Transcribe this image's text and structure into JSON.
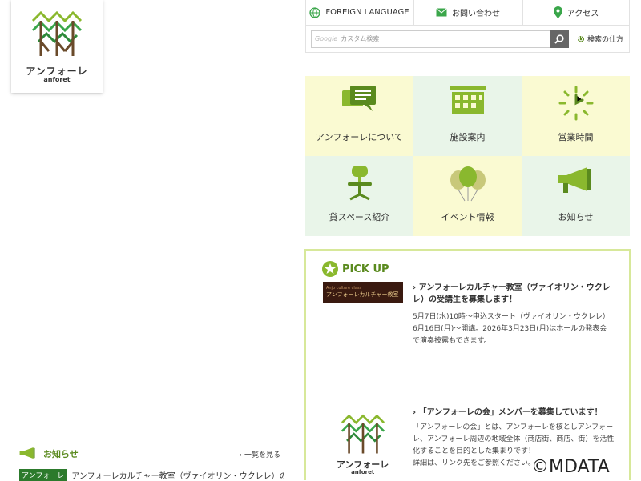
{
  "logo": {
    "name": "アンフォーレ",
    "sub": "anforet"
  },
  "topnav": {
    "foreign": "FOREIGN LANGUAGE",
    "contact": "お問い合わせ",
    "access": "アクセス"
  },
  "search": {
    "google": "Google",
    "placeholder": "カスタム検索",
    "howto": "検索の仕方"
  },
  "tiles": [
    {
      "label": "アンフォーレについて",
      "icon": "chat-icon"
    },
    {
      "label": "施設案内",
      "icon": "building-icon"
    },
    {
      "label": "営業時間",
      "icon": "clock-icon"
    },
    {
      "label": "貸スペース紹介",
      "icon": "chair-icon"
    },
    {
      "label": "イベント情報",
      "icon": "balloon-icon"
    },
    {
      "label": "お知らせ",
      "icon": "megaphone-icon"
    }
  ],
  "pickup": {
    "heading": "PICK UP",
    "thumb_small": "Anjo culture class",
    "thumb_text": "アンフォーレカルチャー教室",
    "item1_title": "アンフォーレカルチャー教室（ヴァイオリン・ウクレレ）の受講生を募集します！",
    "item1_body": "5月7日(水)10時〜申込スタート（ヴァイオリン・ウクレレ）\n6月16日(月)〜開講。2026年3月23日(月)はホールの発表会で演奏披露もできます。",
    "item2_title": "「アンフォーレの会」メンバーを募集しています！",
    "item2_body": "「アンフォーレの会」とは、アンフォーレを核としアンフォーレ、アンフォーレ周辺の地域全体（商店街、商店、街）を活性化することを目的とした集まりです！\n詳細は、リンク先をご参照ください。",
    "logo_name": "アンフォーレ",
    "logo_sub": "anforet"
  },
  "news": {
    "heading": "お知らせ",
    "more": "› 一覧を見る",
    "tag": "アンフォーレ",
    "text": "アンフォーレカルチャー教室（ヴァイオリン・ウクレレ）の受"
  },
  "watermark": "©MDATA",
  "colors": {
    "accent": "#5a8a1e",
    "tile_yellow": "#fafad2",
    "tile_green": "#e9f5e9",
    "icon_green": "#8ab82e"
  }
}
